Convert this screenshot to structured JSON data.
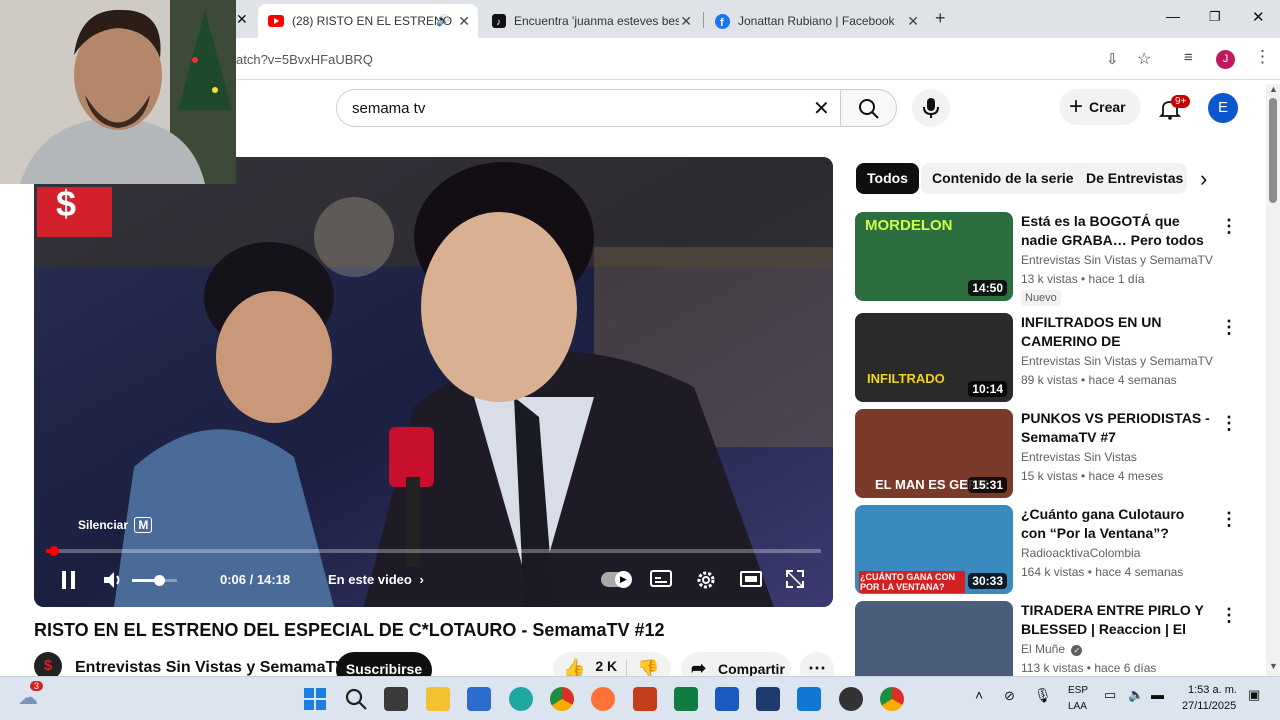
{
  "browser": {
    "tabs": [
      {
        "title": "(28) RISTO EN EL ESTRENO",
        "favicon": "youtube-icon",
        "active": true
      },
      {
        "title": "Encuentra 'juanma esteves bes",
        "favicon": "tiktok-icon",
        "active": false
      },
      {
        "title": "Jonattan Rubiano | Facebook",
        "favicon": "facebook-icon",
        "active": false
      }
    ],
    "new_tab": "+",
    "url": "atch?v=5BvxHFaUBRQ",
    "profile_initial": "J"
  },
  "header": {
    "search_value": "semama tv",
    "create_label": "Crear",
    "notifications_badge": "9+",
    "avatar_initial": "E"
  },
  "player": {
    "mute_tooltip": "Silenciar",
    "mute_shortcut": "M",
    "time": "0:06 / 14:18",
    "chapters_label": "En este video",
    "progress_fraction": 0.007,
    "volume_fraction": 0.6
  },
  "video": {
    "title": "RISTO EN EL ESTRENO DEL ESPECIAL DE C*LOTAURO - SemamaTV #12",
    "channel": "Entrevistas Sin Vistas y SemamaTV",
    "subscribe_label": "Suscribirse",
    "likes": "2 K",
    "share_label": "Compartir"
  },
  "chips": [
    "Todos",
    "Contenido de la serie",
    "De Entrevistas S"
  ],
  "recommendations": [
    {
      "title": "Está es la BOGOTÁ que nadie GRABA… Pero todos hemos …",
      "channel": "Entrevistas Sin Vistas y SemamaTV",
      "meta": "13 k vistas • hace 1 día",
      "badge": "Nuevo",
      "duration": "14:50",
      "thumb_text": "MORDELON",
      "thumb_color": "#2c6e3f"
    },
    {
      "title": "INFILTRADOS EN UN CAMERINO DE COMEDIANTES…",
      "channel": "Entrevistas Sin Vistas y SemamaTV",
      "meta": "89 k vistas • hace 4 semanas",
      "badge": "",
      "duration": "10:14",
      "thumb_text": "INFILTRADO",
      "thumb_color": "#2a2a2a"
    },
    {
      "title": "PUNKOS VS PERIODISTAS - SemamaTV #7",
      "channel": "Entrevistas Sin Vistas",
      "meta": "15 k vistas • hace 4 meses",
      "badge": "",
      "duration": "15:31",
      "thumb_text": "EL MAN ES GERM",
      "thumb_color": "#7a3a2a"
    },
    {
      "title": "¿Cuánto gana Culotauro con “Por la Ventana”? Anuncia su …",
      "channel": "RadioacktivaColombia",
      "meta": "164 k vistas • hace 4 semanas",
      "badge": "",
      "duration": "30:33",
      "thumb_text": "¿CUÁNTO GANA CON POR LA VENTANA?",
      "thumb_color": "#3a8ac0"
    },
    {
      "title": "TIRADERA ENTRE PIRLO Y BLESSED | Reaccion | El Muñe",
      "channel": "El Muñe",
      "meta": "113 k vistas • hace 6 días",
      "badge": "",
      "duration": "",
      "thumb_text": "",
      "thumb_color": "#4a5e7a"
    }
  ],
  "taskbar": {
    "weather_badge": "3",
    "language": "ESP",
    "region": "LAA",
    "time": "1:53 a. m.",
    "date": "27/11/2025"
  }
}
